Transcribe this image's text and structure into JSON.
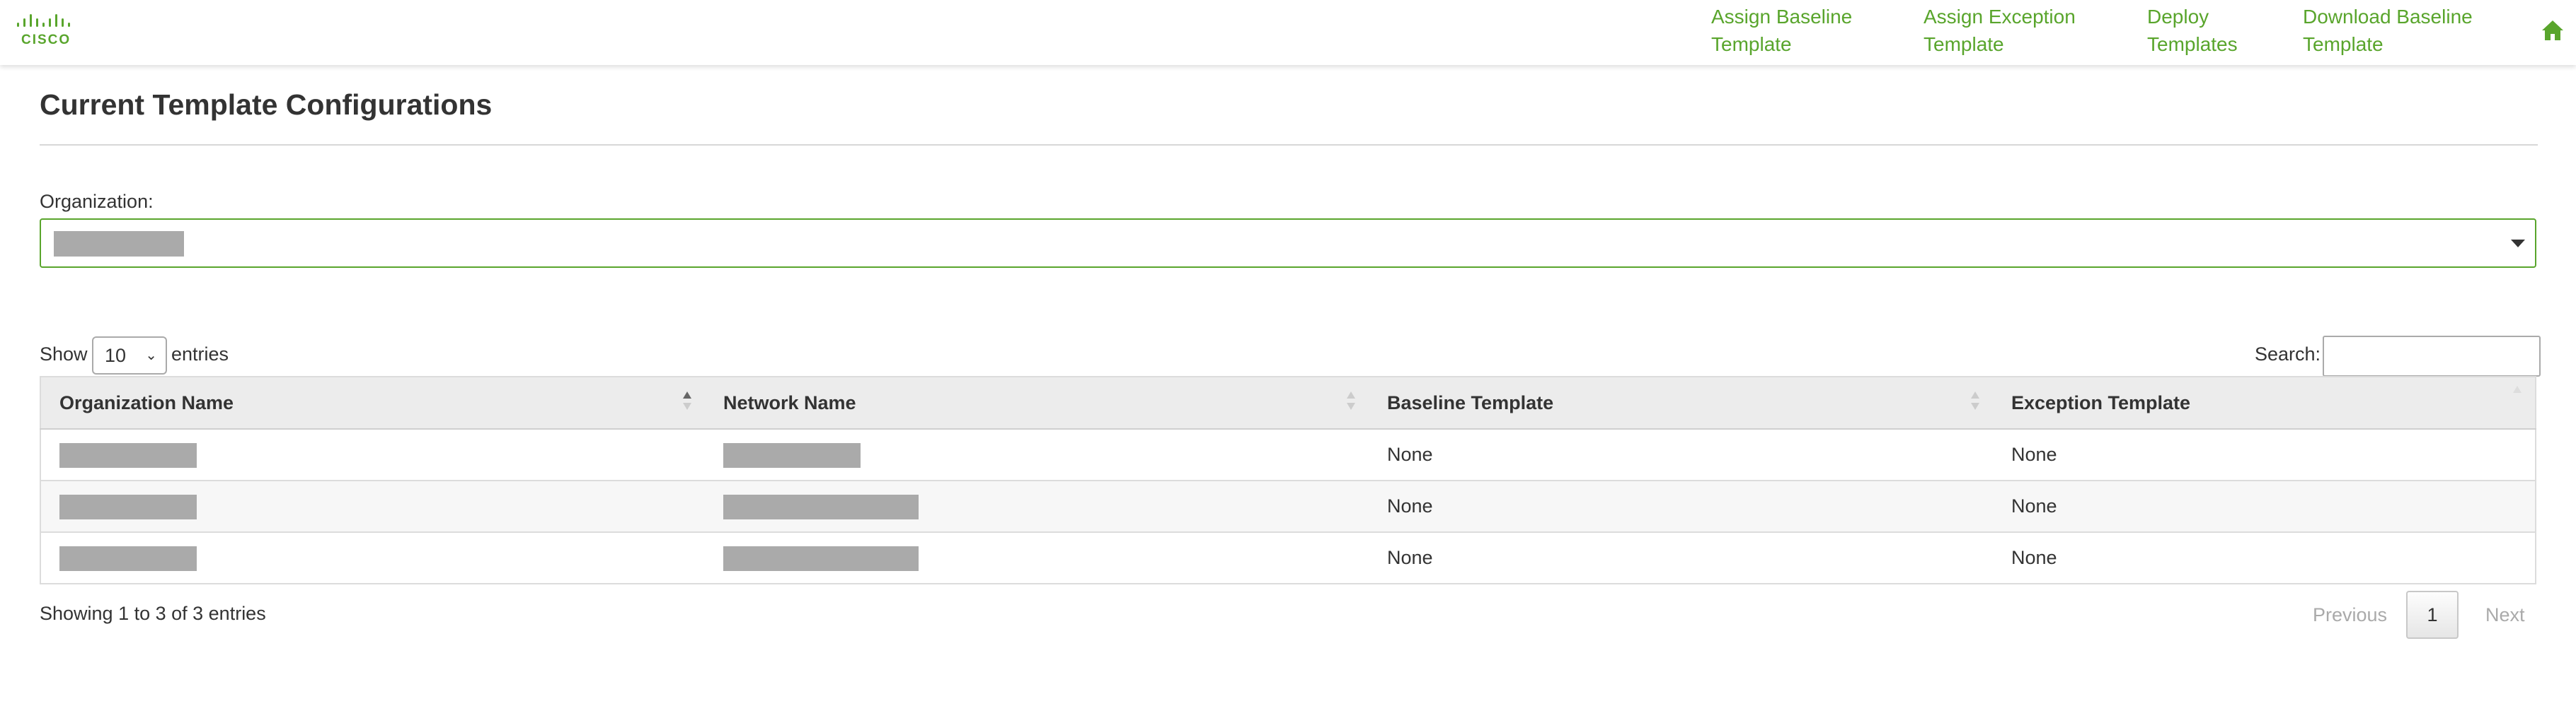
{
  "brand": {
    "logo_text": "CISCO",
    "accent_color": "#59a52c"
  },
  "nav": {
    "items": [
      {
        "label_line1": "Assign Baseline",
        "label_line2": "Template"
      },
      {
        "label_line1": "Assign Exception",
        "label_line2": "Template"
      },
      {
        "label_line1": "Deploy",
        "label_line2": "Templates"
      },
      {
        "label_line1": "Download Baseline",
        "label_line2": "Template"
      }
    ],
    "home_icon": "home-icon"
  },
  "page": {
    "title": "Current Template Configurations"
  },
  "organization": {
    "label": "Organization:",
    "selected_value_redacted": true
  },
  "table_controls": {
    "show_label": "Show",
    "page_length": "10",
    "entries_label": "entries",
    "search_label": "Search:",
    "search_value": ""
  },
  "table": {
    "columns": [
      "Organization Name",
      "Network Name",
      "Baseline Template",
      "Exception Template"
    ],
    "rows": [
      {
        "organization_name": "[redacted]",
        "network_name": "[redacted]",
        "baseline_template": "None",
        "exception_template": "None"
      },
      {
        "organization_name": "[redacted]",
        "network_name": "[redacted]",
        "baseline_template": "None",
        "exception_template": "None"
      },
      {
        "organization_name": "[redacted]",
        "network_name": "[redacted]",
        "baseline_template": "None",
        "exception_template": "None"
      }
    ]
  },
  "footer": {
    "info": "Showing 1 to 3 of 3 entries",
    "previous_label": "Previous",
    "current_page": "1",
    "next_label": "Next"
  }
}
